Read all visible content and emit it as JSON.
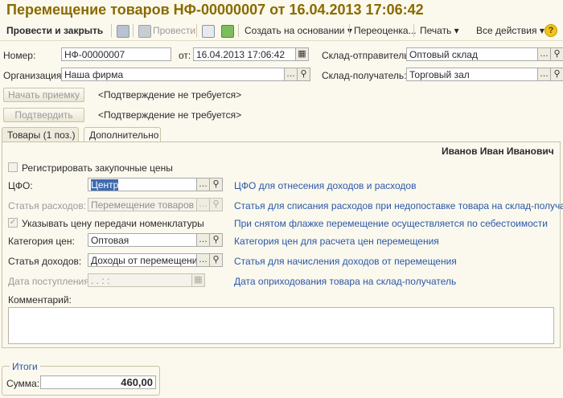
{
  "window": {
    "title": "Перемещение товаров НФ-00000007 от 16.04.2013 17:06:42"
  },
  "toolbar": {
    "post_close": "Провести и закрыть",
    "post": "Провести",
    "create_based": "Создать на основании",
    "revaluation": "Переоценка...",
    "print": "Печать",
    "all_actions": "Все действия",
    "help": "?"
  },
  "header": {
    "number_label": "Номер:",
    "number_value": "НФ-00000007",
    "date_label": "от:",
    "date_value": "16.04.2013 17:06:42",
    "org_label": "Организация:",
    "org_value": "Наша фирма",
    "sender_label": "Склад-отправитель:",
    "sender_value": "Оптовый склад",
    "receiver_label": "Склад-получатель:",
    "receiver_value": "Торговый зал",
    "start_accept_button": "Начать приемку",
    "confirm_button": "Подтвердить",
    "not_required_1": "<Подтверждение не требуется>",
    "not_required_2": "<Подтверждение не требуется>"
  },
  "tabs": [
    {
      "label": "Товары (1 поз.)"
    },
    {
      "label": "Дополнительно"
    }
  ],
  "additional": {
    "responsible": "Иванов Иван Иванович",
    "register_prices_label": "Регистрировать закупочные цены",
    "cfo_label": "ЦФО:",
    "cfo_value": "Центр",
    "cfo_hint": "ЦФО для отнесения доходов и расходов",
    "expense_label": "Статья расходов:",
    "expense_value": "Перемещение товаров",
    "expense_hint": "Статья для списания расходов при недопоставке товара на склад-получатель",
    "transfer_price_label": "Указывать цену передачи номенклатуры",
    "transfer_price_hint": "При снятом флажке перемещение осуществляется по себестоимости",
    "price_cat_label": "Категория цен:",
    "price_cat_value": "Оптовая",
    "price_cat_hint": "Категория цен для расчета цен перемещения",
    "income_label": "Статья доходов:",
    "income_value": "Доходы от перемещения",
    "income_hint": "Статья для начисления доходов от перемещения",
    "receipt_date_label": "Дата поступления:",
    "receipt_date_value": ".  .      :  :",
    "receipt_date_hint": "Дата оприходования товара на склад-получатель",
    "comment_label": "Комментарий:"
  },
  "totals": {
    "group_title": "Итоги",
    "sum_label": "Сумма:",
    "sum_value": "460,00"
  }
}
